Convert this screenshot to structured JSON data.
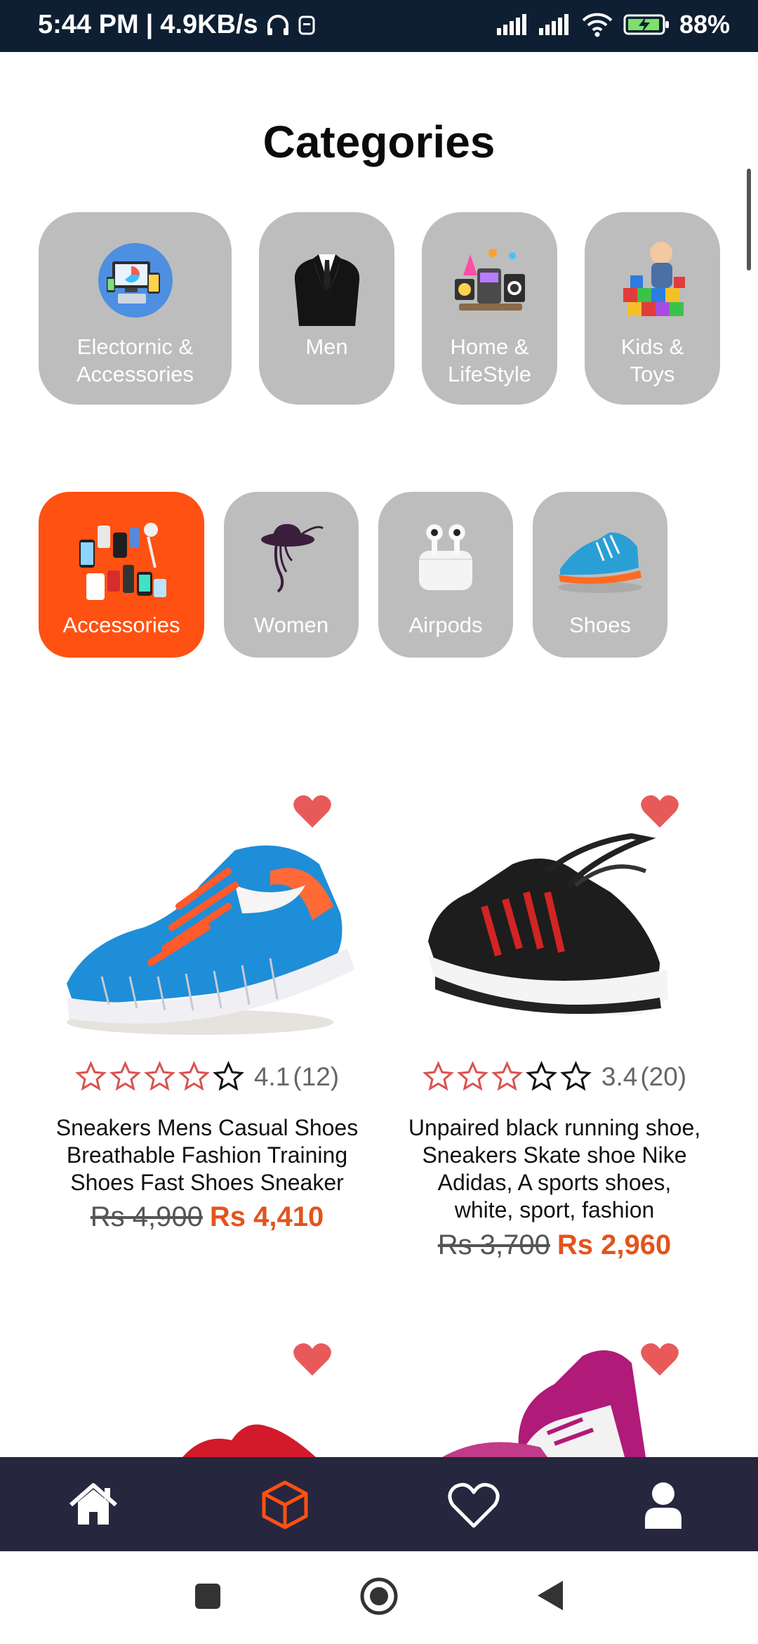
{
  "status_bar": {
    "time": "5:44 PM",
    "speed": "4.9KB/s",
    "battery": "88%",
    "icons": [
      "headphones-icon",
      "sim-icon",
      "signal-icon",
      "signal-icon",
      "wifi-icon",
      "battery-charging-icon"
    ]
  },
  "page": {
    "title": "Categories"
  },
  "categories_row1": [
    {
      "label_line1": "Electornic &",
      "label_line2": "Accessories",
      "icon": "electronics-devices-icon"
    },
    {
      "label_line1": "Men",
      "label_line2": "",
      "icon": "suit-icon"
    },
    {
      "label_line1": "Home &",
      "label_line2": "LifeStyle",
      "icon": "home-appliances-icon"
    },
    {
      "label_line1": "Kids &",
      "label_line2": "Toys",
      "icon": "toy-blocks-icon"
    }
  ],
  "categories_row2": [
    {
      "label": "Accessories",
      "icon": "gadgets-icon",
      "selected": true
    },
    {
      "label": "Women",
      "icon": "woman-hat-icon",
      "selected": false
    },
    {
      "label": "Airpods",
      "icon": "airpods-icon",
      "selected": false
    },
    {
      "label": "Shoes",
      "icon": "sneaker-icon",
      "selected": false
    }
  ],
  "products": [
    {
      "title_lines": [
        "Sneakers Mens Casual Shoes",
        "Breathable Fashion Training",
        "Shoes Fast Shoes Sneaker"
      ],
      "rating": "4.1",
      "reviews": "(12)",
      "filled_stars": 4,
      "old_price": "Rs 4,900",
      "new_price": "Rs 4,410",
      "favorited": true,
      "image": "blue-sneaker-image"
    },
    {
      "title_lines": [
        "Unpaired black running shoe,",
        "Sneakers Skate shoe Nike",
        "Adidas, A sports shoes,",
        "white, sport, fashion"
      ],
      "rating": "3.4",
      "reviews": "(20)",
      "filled_stars": 3,
      "old_price": "Rs 3,700",
      "new_price": "Rs 2,960",
      "favorited": true,
      "image": "black-sneaker-image"
    }
  ],
  "colors": {
    "accent": "#ff5112",
    "price": "#e2541c",
    "heart": "#e85a5a",
    "tile": "#bdbdbd",
    "nav_bg": "#26273f",
    "status_bg": "#0e1f33"
  },
  "bottom_nav": [
    {
      "name": "home-icon",
      "active": false
    },
    {
      "name": "cube-icon",
      "active": true
    },
    {
      "name": "heart-icon",
      "active": false
    },
    {
      "name": "user-icon",
      "active": false
    }
  ],
  "system_nav": [
    "square-icon",
    "circle-home-icon",
    "back-triangle-icon"
  ]
}
